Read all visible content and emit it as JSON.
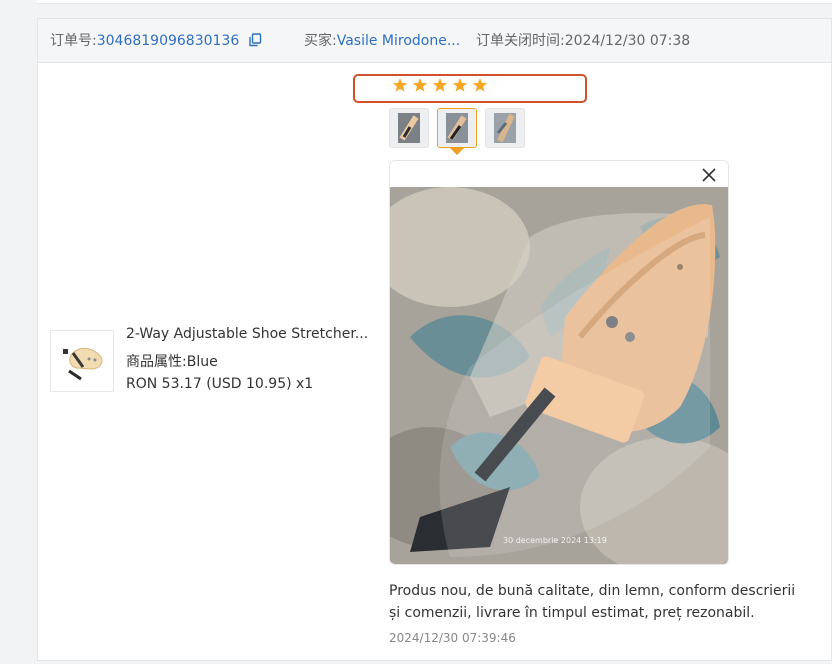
{
  "header": {
    "order_label": "订单号:",
    "order_number": "3046819096830136",
    "buyer_label": "买家:",
    "buyer_name": "Vasile Mirodone...",
    "close_time": "订单关闭时间:2024/12/30 07:38"
  },
  "product": {
    "title": "2-Way Adjustable Shoe Stretcher...",
    "attribute": "商品属性:Blue",
    "price": "RON 53.17 (USD 10.95) x1"
  },
  "review": {
    "rating": 5,
    "star_color": "#f5a623",
    "highlight_color": "#d0512c",
    "image_count": 3,
    "active_image": 2,
    "photo_caption": "30 decembrie 2024 13:19",
    "text": "Produs nou, de bună calitate, din lemn, conform descrierii și comenzii, livrare în timpul estimat, preț rezonabil.",
    "timestamp": "2024/12/30 07:39:46"
  },
  "icons": {
    "copy": "copy-icon",
    "close": "close-icon",
    "star": "star-icon"
  }
}
